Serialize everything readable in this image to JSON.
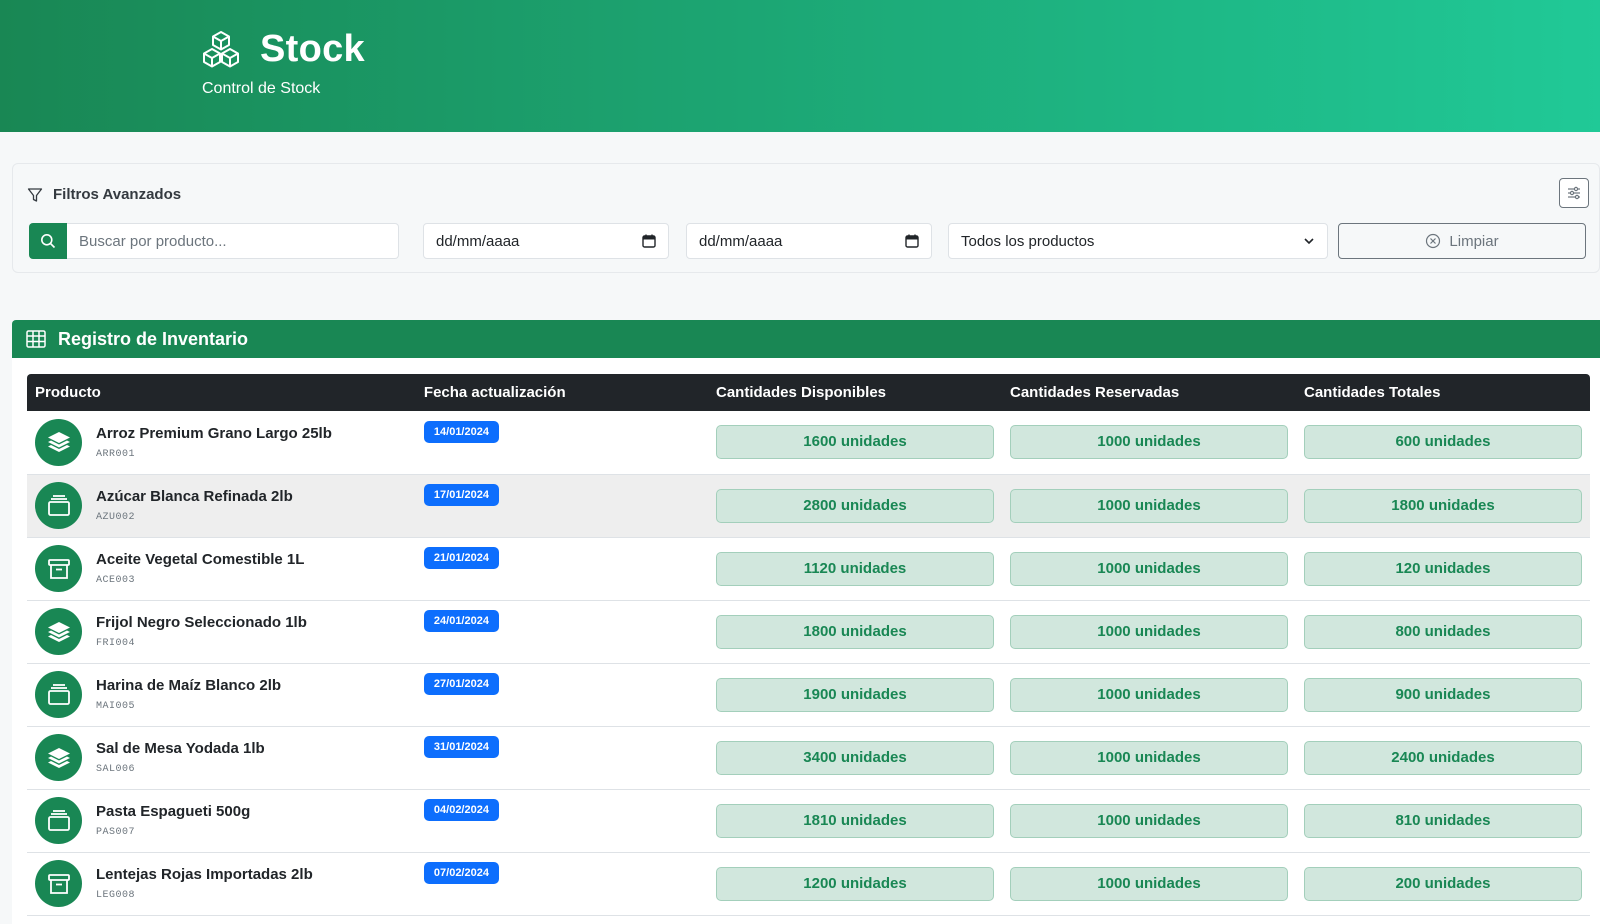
{
  "header": {
    "title": "Stock",
    "subtitle": "Control de Stock",
    "logo_icon": "boxes-icon"
  },
  "filters": {
    "title": "Filtros Avanzados",
    "search_placeholder": "Buscar por producto...",
    "date_from": "dd/mm/aaaa",
    "date_to": "dd/mm/aaaa",
    "product_select": "Todos los productos",
    "clear_label": "Limpiar"
  },
  "inventory": {
    "title": "Registro de Inventario",
    "columns": [
      "Producto",
      "Fecha actualización",
      "Cantidades Disponibles",
      "Cantidades Reservadas",
      "Cantidades Totales"
    ],
    "rows": [
      {
        "name": "Arroz Premium Grano Largo 25lb",
        "code": "ARR001",
        "date": "14/01/2024",
        "available": "1600 unidades",
        "reserved": "1000 unidades",
        "total": "600 unidades",
        "icon": "layers-icon"
      },
      {
        "name": "Azúcar Blanca Refinada 2lb",
        "code": "AZU002",
        "date": "17/01/2024",
        "available": "2800 unidades",
        "reserved": "1000 unidades",
        "total": "1800 unidades",
        "icon": "inbox-icon"
      },
      {
        "name": "Aceite Vegetal Comestible 1L",
        "code": "ACE003",
        "date": "21/01/2024",
        "available": "1120 unidades",
        "reserved": "1000 unidades",
        "total": "120 unidades",
        "icon": "archive-icon"
      },
      {
        "name": "Frijol Negro Seleccionado 1lb",
        "code": "FRI004",
        "date": "24/01/2024",
        "available": "1800 unidades",
        "reserved": "1000 unidades",
        "total": "800 unidades",
        "icon": "layers-icon"
      },
      {
        "name": "Harina de Maíz Blanco 2lb",
        "code": "MAI005",
        "date": "27/01/2024",
        "available": "1900 unidades",
        "reserved": "1000 unidades",
        "total": "900 unidades",
        "icon": "inbox-icon"
      },
      {
        "name": "Sal de Mesa Yodada 1lb",
        "code": "SAL006",
        "date": "31/01/2024",
        "available": "3400 unidades",
        "reserved": "1000 unidades",
        "total": "2400 unidades",
        "icon": "layers-icon"
      },
      {
        "name": "Pasta Espagueti 500g",
        "code": "PAS007",
        "date": "04/02/2024",
        "available": "1810 unidades",
        "reserved": "1000 unidades",
        "total": "810 unidades",
        "icon": "inbox-icon"
      },
      {
        "name": "Lentejas Rojas Importadas 2lb",
        "code": "LEG008",
        "date": "07/02/2024",
        "available": "1200 unidades",
        "reserved": "1000 unidades",
        "total": "200 unidades",
        "icon": "archive-icon"
      }
    ]
  },
  "colors": {
    "primary": "#198754",
    "header_gradient_end": "#20c997",
    "date_badge": "#0d6efd",
    "qty_bg": "#d1e7dd",
    "table_head": "#212529"
  }
}
